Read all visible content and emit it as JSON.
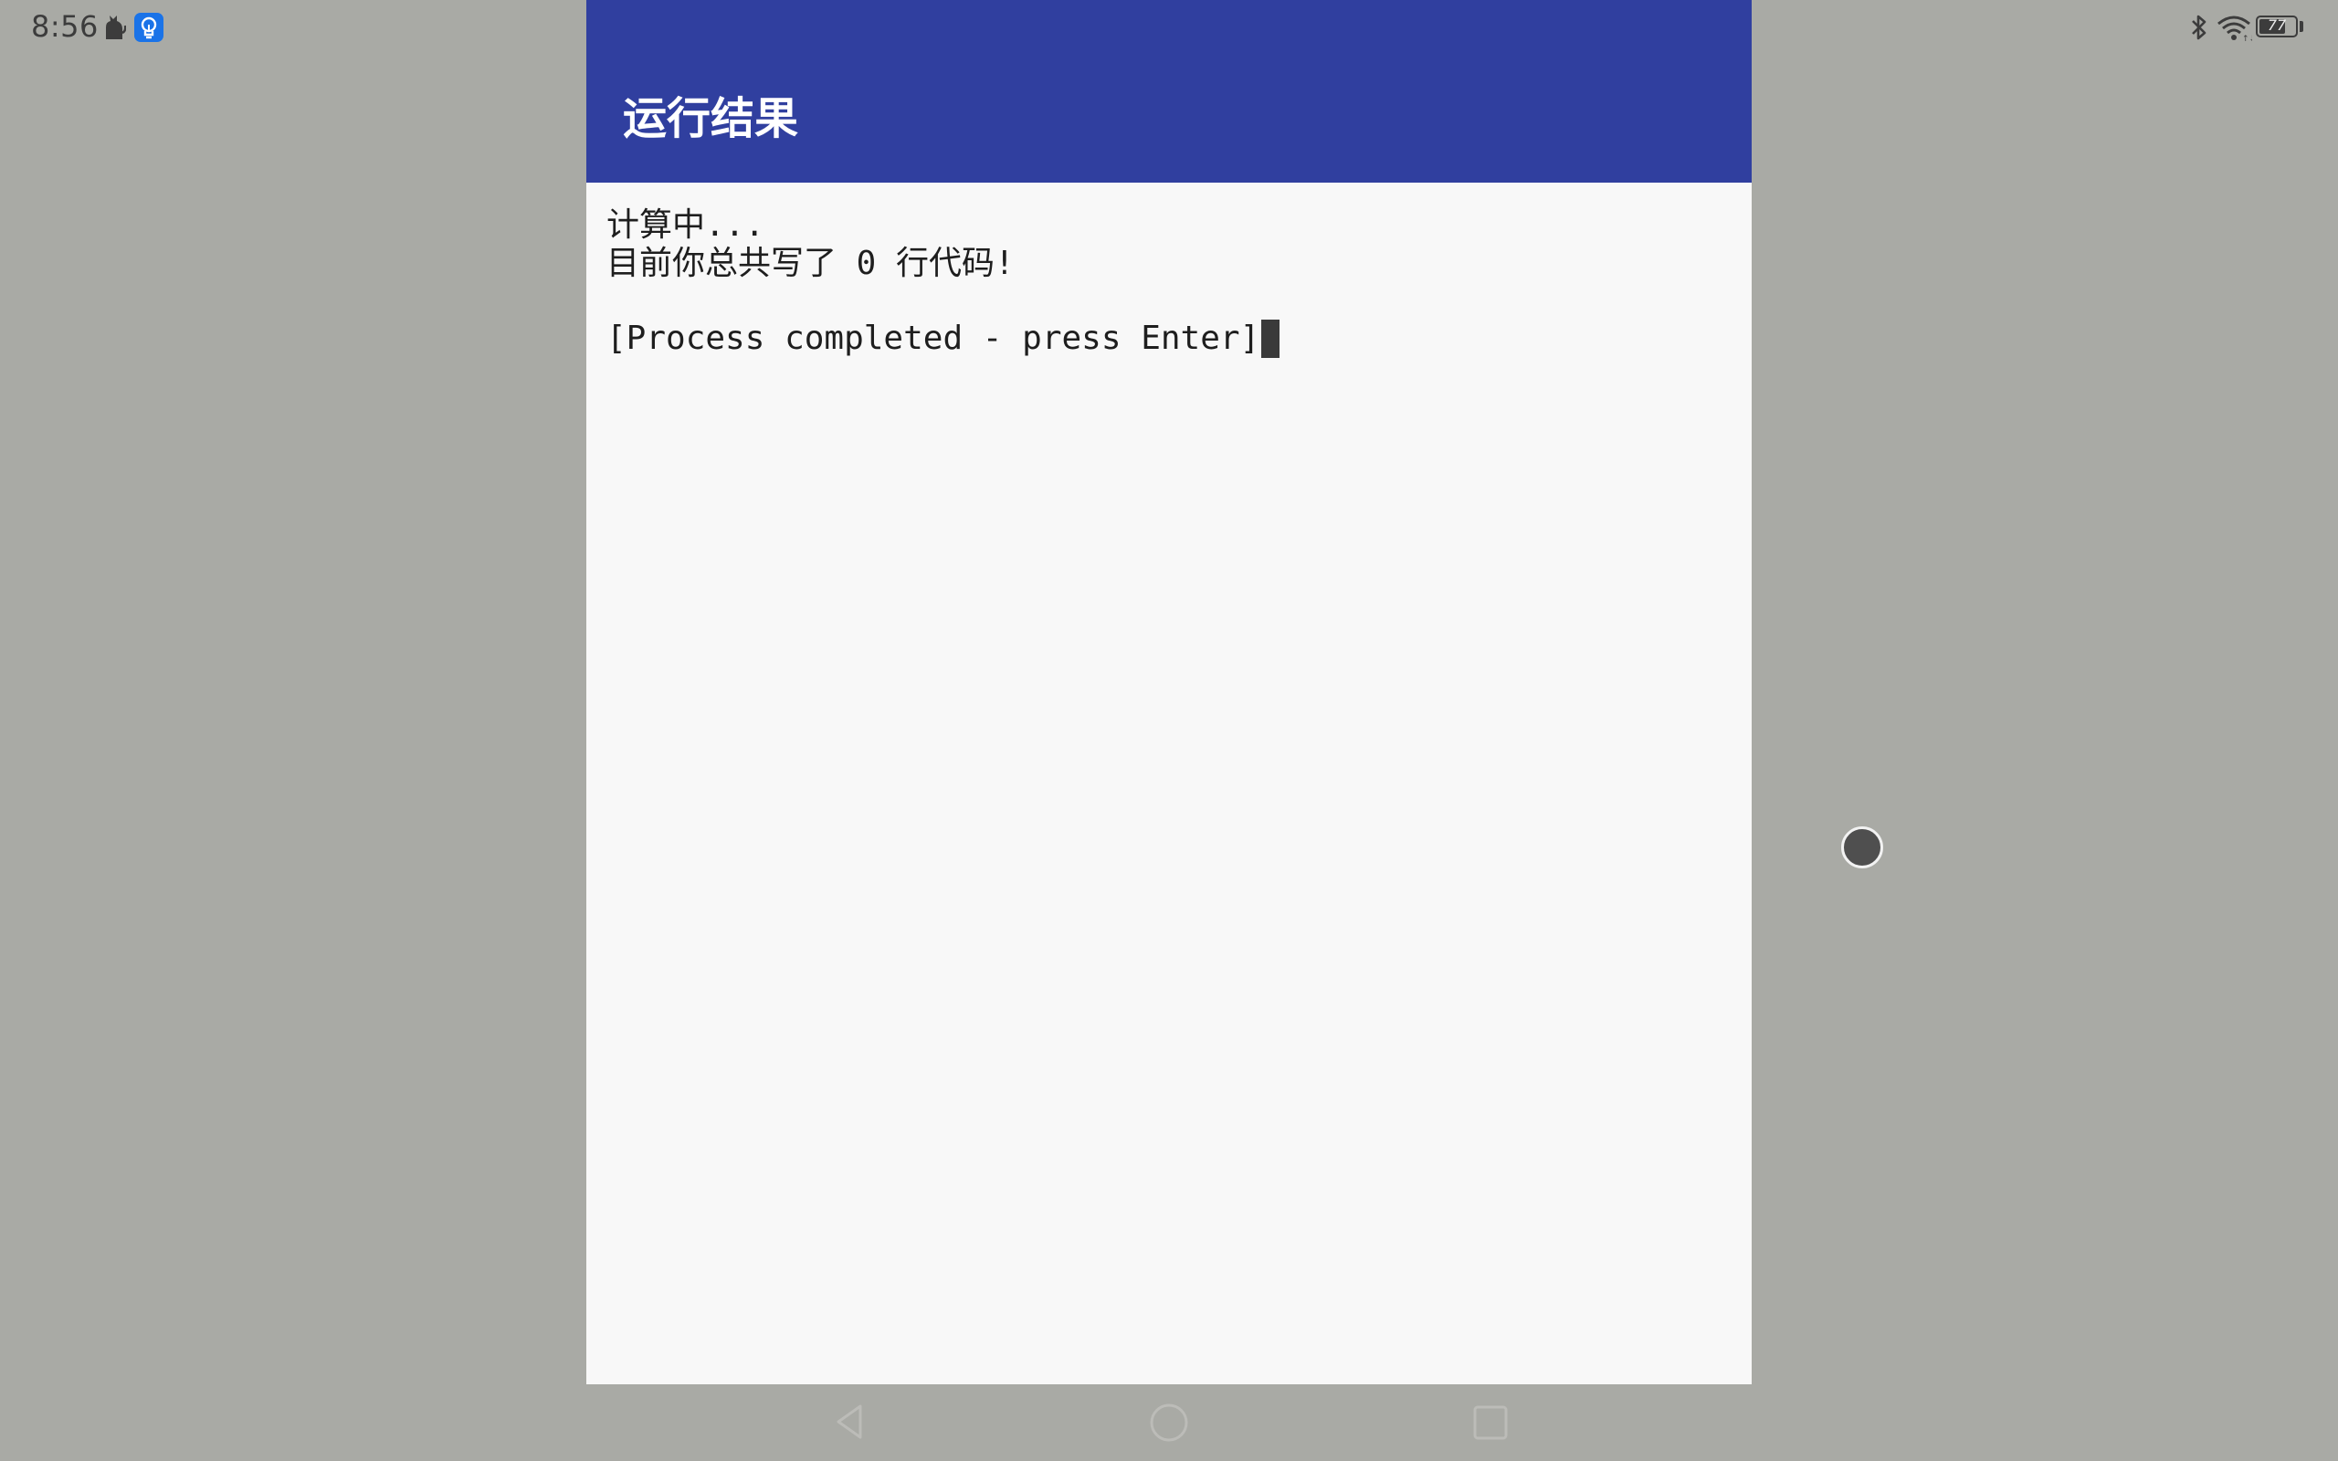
{
  "status_bar": {
    "time": "8:56",
    "battery_level": "77",
    "battery_fraction": 0.77,
    "left_icons": [
      "cat-icon",
      "lightbulb-assistant-icon"
    ],
    "right_icons": [
      "bluetooth-icon",
      "wifi-icon",
      "battery-icon"
    ],
    "assistant_icon_color": "#1a73e8"
  },
  "app_bar": {
    "title": "运行结果",
    "color": "#303f9f"
  },
  "terminal": {
    "lines": [
      "计算中...",
      "目前你总共写了 0 行代码!"
    ],
    "final_line": "[Process completed - press Enter]"
  },
  "navigation": {
    "buttons": [
      "back-icon",
      "home-icon",
      "recents-icon"
    ]
  }
}
